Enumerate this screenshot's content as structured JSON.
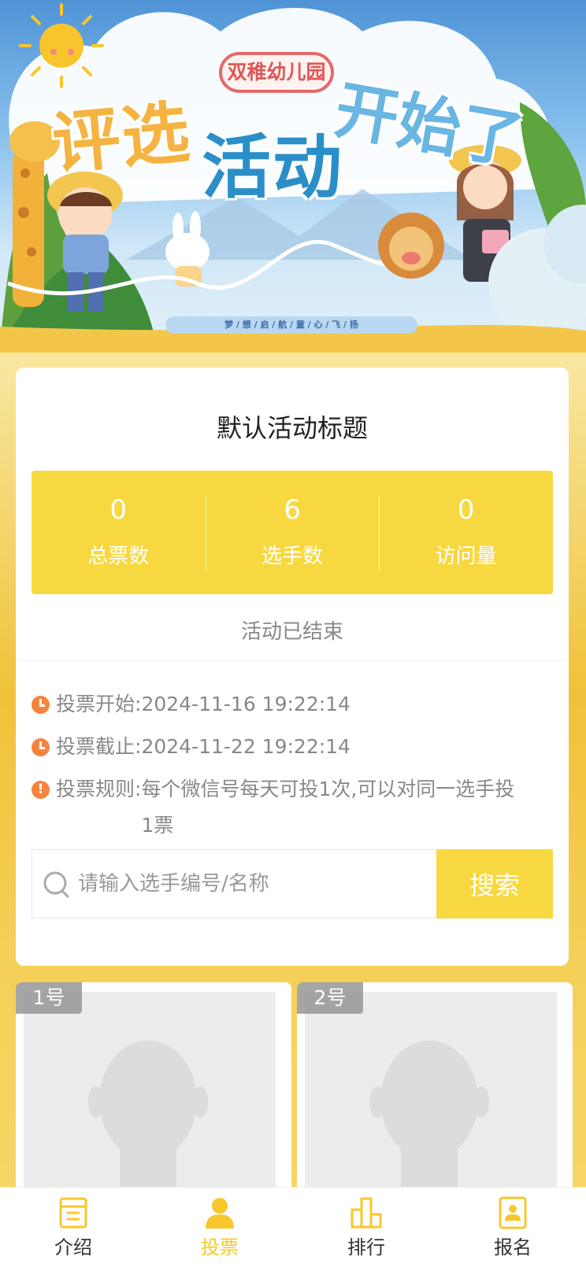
{
  "banner": {
    "kindergarten": "双稚幼儿园",
    "headline_1": "评选",
    "headline_2": "活动",
    "headline_3": "开始了",
    "slogan": "梦 / 想 / 启 / 航 / 童 / 心 / 飞 / 扬"
  },
  "activity": {
    "title": "默认活动标题",
    "stats": [
      {
        "value": "0",
        "label": "总票数"
      },
      {
        "value": "6",
        "label": "选手数"
      },
      {
        "value": "0",
        "label": "访问量"
      }
    ],
    "status": "活动已结束",
    "start_label": "投票开始:",
    "start_value": "2024-11-16 19:22:14",
    "end_label": "投票截止:",
    "end_value": "2024-11-22 19:22:14",
    "rule_label": "投票规则:",
    "rule_value": "每个微信号每天可投1次,可以对同一选手投1票"
  },
  "search": {
    "placeholder": "请输入选手编号/名称",
    "button": "搜索"
  },
  "contestants": [
    {
      "number": "1号"
    },
    {
      "number": "2号"
    }
  ],
  "tabbar": [
    {
      "label": "介绍",
      "icon": "document-icon",
      "active": false
    },
    {
      "label": "投票",
      "icon": "user-icon",
      "active": true
    },
    {
      "label": "排行",
      "icon": "ranking-icon",
      "active": false
    },
    {
      "label": "报名",
      "icon": "id-card-icon",
      "active": false
    }
  ],
  "colors": {
    "accent": "#f8d840",
    "active_tab": "#f8c72b",
    "info_icon": "#f6843f"
  }
}
